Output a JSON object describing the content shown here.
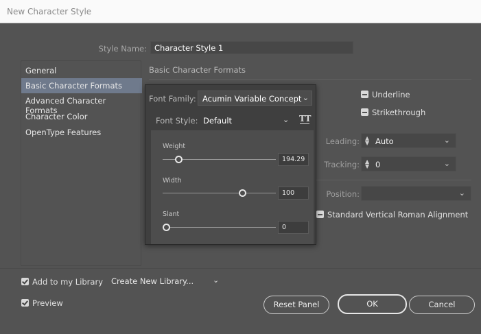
{
  "window": {
    "title": "New Character Style"
  },
  "style_name": {
    "label": "Style Name:",
    "value": "Character Style 1"
  },
  "sidebar": {
    "items": [
      {
        "label": "General",
        "selected": false
      },
      {
        "label": "Basic Character Formats",
        "selected": true
      },
      {
        "label": "Advanced Character Formats",
        "selected": false
      },
      {
        "label": "Character Color",
        "selected": false
      },
      {
        "label": "OpenType Features",
        "selected": false
      }
    ]
  },
  "main": {
    "section_title": "Basic Character Formats",
    "underline": {
      "label": "Underline",
      "state": "indeterminate"
    },
    "strikethrough": {
      "label": "Strikethrough",
      "state": "indeterminate"
    },
    "leading": {
      "label": "Leading:",
      "value": "Auto"
    },
    "tracking": {
      "label": "Tracking:",
      "value": "0"
    },
    "position": {
      "label": "Position:",
      "value": ""
    },
    "standard_vertical": {
      "label": "Standard Vertical Roman Alignment",
      "state": "indeterminate"
    }
  },
  "font_popup": {
    "font_family_label": "Font Family:",
    "font_family_value": "Acumin Variable Concept",
    "font_style_label": "Font Style:",
    "font_style_value": "Default",
    "variable_icon": "variable-font-icon",
    "axes": [
      {
        "label": "Weight",
        "value": "194.29",
        "fraction": 0.12
      },
      {
        "label": "Width",
        "value": "100",
        "fraction": 0.72
      },
      {
        "label": "Slant",
        "value": "0",
        "fraction": 0.0
      }
    ]
  },
  "footer": {
    "add_to_library": {
      "label": "Add to my Library",
      "checked": true
    },
    "library_dropdown": {
      "value": "Create New Library..."
    },
    "preview": {
      "label": "Preview",
      "checked": true
    },
    "buttons": {
      "reset": "Reset Panel",
      "ok": "OK",
      "cancel": "Cancel"
    }
  },
  "colors": {
    "background": "#535353",
    "selection": "#6f7a8c",
    "popup": "#3f3f3f"
  }
}
